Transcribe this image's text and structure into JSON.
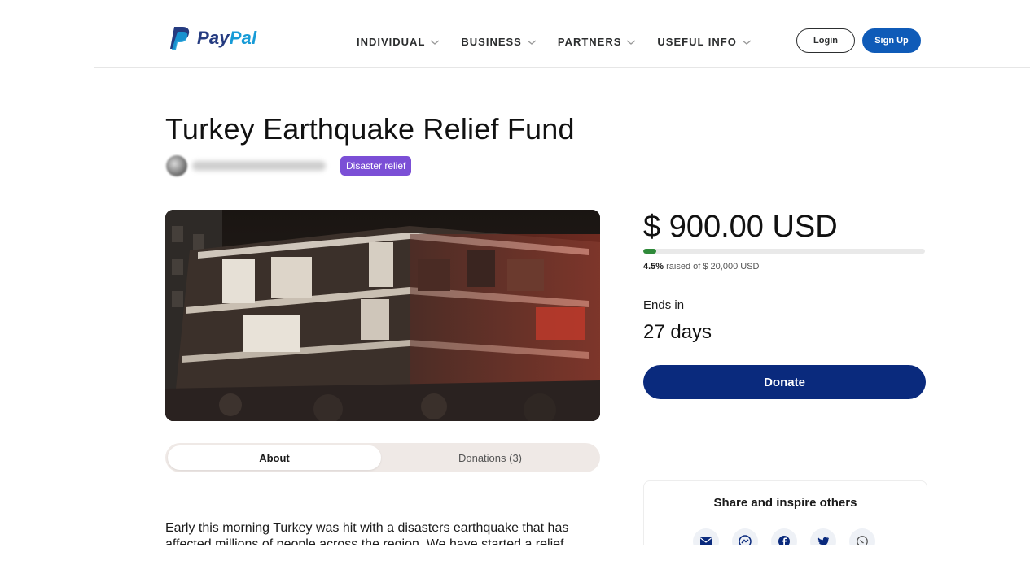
{
  "brand": {
    "name_part1": "Pay",
    "name_part2": "Pal"
  },
  "nav": [
    {
      "label": "INDIVIDUAL"
    },
    {
      "label": "BUSINESS"
    },
    {
      "label": "PARTNERS"
    },
    {
      "label": "USEFUL INFO"
    }
  ],
  "auth": {
    "login_label": "Login",
    "signup_label": "Sign Up"
  },
  "campaign": {
    "title": "Turkey Earthquake Relief Fund",
    "tag": "Disaster relief",
    "amount": "$ 900.00 USD",
    "progress_fraction": 0.045,
    "percent": "4.5%",
    "raised_text": " raised of $ 20,000 USD",
    "ends_label": "Ends in",
    "ends_value": "27 days",
    "donate_label": "Donate"
  },
  "tabs": [
    {
      "label": "About",
      "active": true
    },
    {
      "label": "Donations (3)",
      "active": false
    }
  ],
  "description": "Early this morning Turkey was hit with a disasters earthquake that has affected millions of people across the region. We have started a relief",
  "share": {
    "title": "Share and inspire others",
    "icons": [
      "email-icon",
      "messenger-icon",
      "facebook-icon",
      "twitter-icon",
      "whatsapp-icon"
    ]
  },
  "colors": {
    "brand_dark": "#253b80",
    "brand_light": "#179bd7",
    "signup_bg": "#0f5bb8",
    "donate_bg": "#0a2a7d",
    "tag_bg": "#7b4fd6",
    "progress_fill": "#2f8a3a"
  }
}
